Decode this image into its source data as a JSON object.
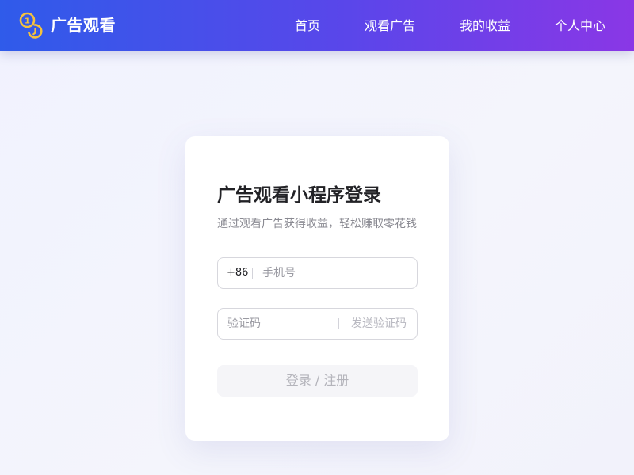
{
  "header": {
    "brand_name": "广告观看",
    "logo_icon": "coins-icon",
    "brand_color": "#f4c23d",
    "nav": [
      {
        "label": "首页"
      },
      {
        "label": "观看广告"
      },
      {
        "label": "我的收益"
      },
      {
        "label": "个人中心"
      }
    ],
    "gradient": [
      "#2f5bea",
      "#8a37e6"
    ]
  },
  "login": {
    "title": "广告观看小程序登录",
    "subtitle": "通过观看广告获得收益，轻松赚取零花钱",
    "country_code": "+86",
    "phone_placeholder": "手机号",
    "code_placeholder": "验证码",
    "send_code_label": "发送验证码",
    "submit_label": "登录 / 注册"
  }
}
